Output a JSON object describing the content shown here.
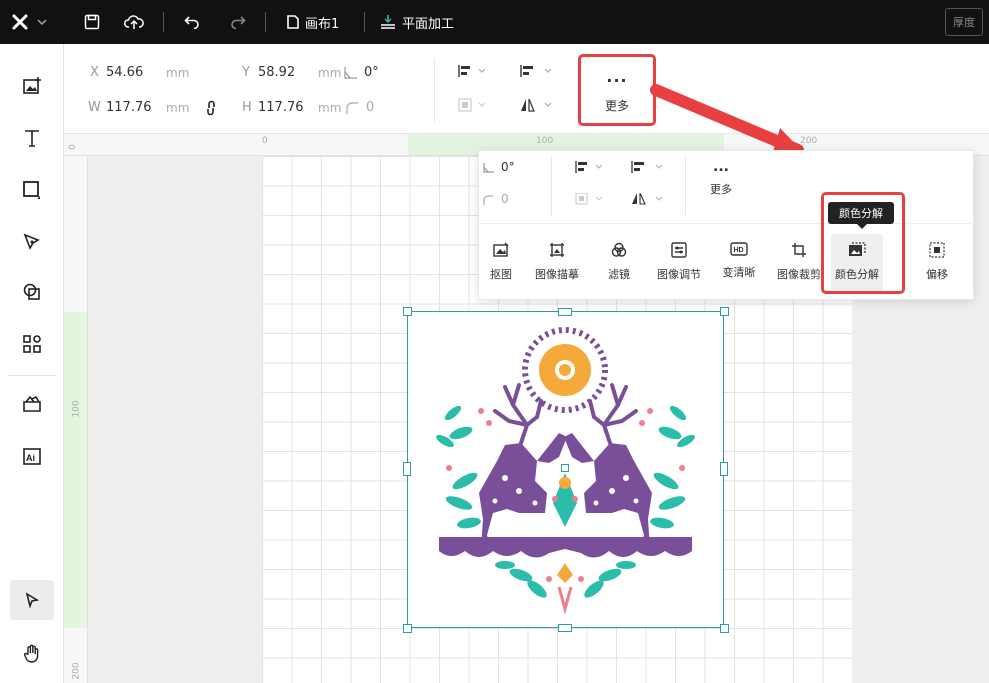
{
  "topbar": {
    "canvas_name": "画布1",
    "mode_name": "平面加工",
    "thickness_label": "厚度"
  },
  "props": {
    "x_label": "X",
    "x_value": "54.66",
    "x_unit": "mm",
    "y_label": "Y",
    "y_value": "58.92",
    "y_unit": "mm",
    "rotation_value": "0°",
    "w_label": "W",
    "w_value": "117.76",
    "w_unit": "mm",
    "h_label": "H",
    "h_value": "117.76",
    "h_unit": "mm",
    "corner_value": "0",
    "more_dots": "...",
    "more_label": "更多"
  },
  "ruler": {
    "h_labels": [
      "0",
      "100",
      "200"
    ],
    "v_labels": [
      "0",
      "100",
      "200"
    ]
  },
  "panel": {
    "rotation_value": "0°",
    "corner_value": "0",
    "more_dots": "...",
    "more_label": "更多",
    "tools": [
      {
        "label": "抠图",
        "icon": "cutout-icon"
      },
      {
        "label": "图像描摹",
        "icon": "trace-icon"
      },
      {
        "label": "滤镜",
        "icon": "filter-icon"
      },
      {
        "label": "图像调节",
        "icon": "adjust-icon"
      },
      {
        "label": "变清晰",
        "icon": "hd-icon"
      },
      {
        "label": "图像裁剪",
        "icon": "crop-icon"
      },
      {
        "label": "颜色分解",
        "icon": "color-split-icon"
      },
      {
        "label": "偏移",
        "icon": "offset-icon"
      }
    ]
  },
  "tooltip": "颜色分解",
  "colors": {
    "accent_red": "#e84040",
    "selection": "#2aa198",
    "purple": "#7a4f9a",
    "teal": "#2bbcaa",
    "orange": "#f6a93b",
    "pink": "#ef7f8f"
  }
}
